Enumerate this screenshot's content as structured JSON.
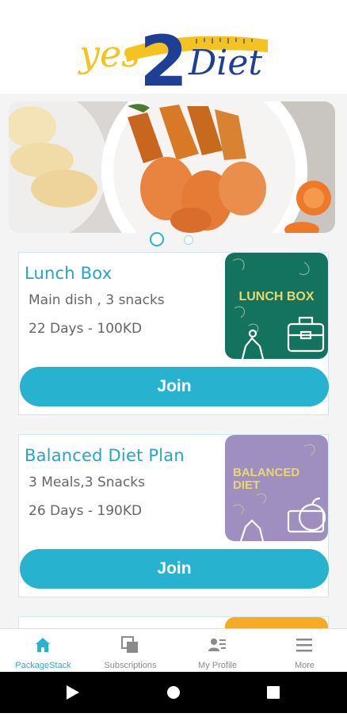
{
  "app": {
    "logo_text_left": "yes",
    "logo_text_number": "2",
    "logo_text_right": "Diet"
  },
  "carousel": {
    "slides_count": 2,
    "active_slide": 1
  },
  "packages": [
    {
      "title": "Lunch Box",
      "description": "Main dish , 3 snacks",
      "duration_price": "22 Days - 100KD",
      "image_label": "LUNCH BOX",
      "join_label": "Join",
      "image_color": "#13735f"
    },
    {
      "title": "Balanced Diet Plan",
      "description": "3 Meals,3 Snacks",
      "duration_price": "26 Days - 190KD",
      "image_label_line1": "BALANCED",
      "image_label_line2": "DIET",
      "join_label": "Join",
      "image_color": "#9e8fc0"
    }
  ],
  "tabbar": {
    "tabs": [
      {
        "label": "PackageStack",
        "icon": "home-icon",
        "active": true
      },
      {
        "label": "Subscriptions",
        "icon": "subscriptions-icon",
        "active": false
      },
      {
        "label": "My Profile",
        "icon": "profile-icon",
        "active": false
      },
      {
        "label": "More",
        "icon": "menu-icon",
        "active": false
      }
    ]
  },
  "colors": {
    "accent": "#27b2cf",
    "logo_yellow": "#f4c320",
    "logo_blue": "#1f3f96"
  }
}
